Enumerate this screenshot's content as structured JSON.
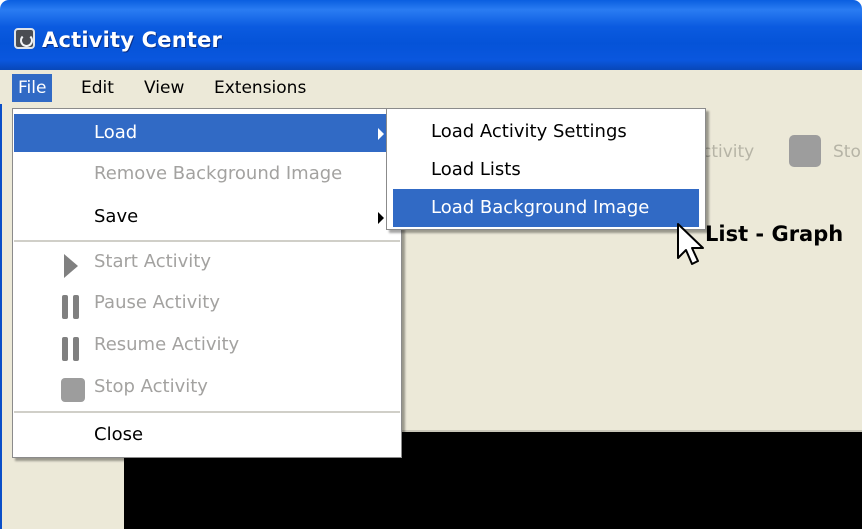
{
  "window": {
    "title": "Activity Center"
  },
  "menubar": {
    "items": [
      {
        "label": "File",
        "active": true
      },
      {
        "label": "Edit"
      },
      {
        "label": "View"
      },
      {
        "label": "Extensions"
      }
    ]
  },
  "file_menu": {
    "items": [
      {
        "label": "Load",
        "state": "highlighted",
        "submenu": true
      },
      {
        "label": "Remove Background Image",
        "state": "disabled"
      },
      {
        "label": "Save",
        "submenu": true
      },
      {
        "label": "Start Activity",
        "state": "disabled",
        "icon": "play-icon"
      },
      {
        "label": "Pause Activity",
        "state": "disabled",
        "icon": "pause-icon"
      },
      {
        "label": "Resume Activity",
        "state": "disabled",
        "icon": "pause-icon"
      },
      {
        "label": "Stop Activity",
        "state": "disabled",
        "icon": "stop-icon"
      },
      {
        "label": "Close"
      }
    ]
  },
  "load_submenu": {
    "items": [
      {
        "label": "Load Activity Settings"
      },
      {
        "label": "Load Lists"
      },
      {
        "label": "Load Background Image",
        "state": "highlighted"
      }
    ]
  },
  "toolbar": {
    "partial_activity_label": "ctivity",
    "partial_stop_label": "Sto"
  },
  "panel": {
    "heading_partial": "List - Graph"
  },
  "colors": {
    "title_bar": "#0a5fe0",
    "menu_highlight": "#316ac5",
    "window_background": "#ece9d8",
    "disabled_text": "#a3a2a0"
  }
}
